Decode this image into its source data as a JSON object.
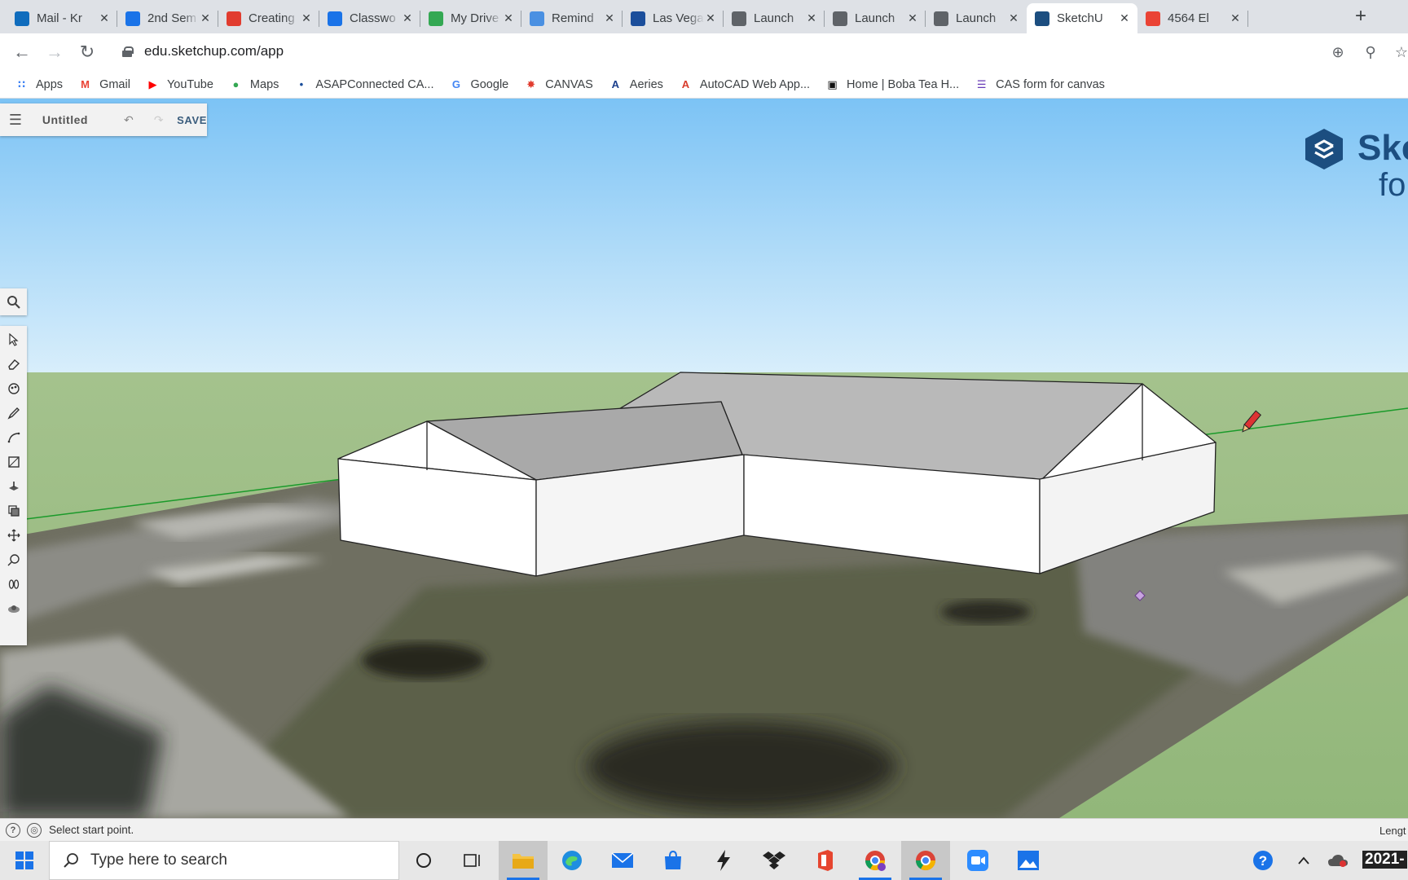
{
  "browser": {
    "tabs": [
      {
        "label": "Mail - Kr",
        "icon": "outlook-icon",
        "color": "#0f6cbd"
      },
      {
        "label": "2nd Sem",
        "icon": "classroom-icon",
        "color": "#1a73e8"
      },
      {
        "label": "Creating",
        "icon": "canvas-icon",
        "color": "#e13c2f"
      },
      {
        "label": "Classwo",
        "icon": "classroom-icon",
        "color": "#1a73e8"
      },
      {
        "label": "My Drive",
        "icon": "drive-icon",
        "color": "#34a853"
      },
      {
        "label": "Remind",
        "icon": "remind-icon",
        "color": "#4a90e2"
      },
      {
        "label": "Las Vega",
        "icon": "golf-icon",
        "color": "#1b4e9b"
      },
      {
        "label": "Launch",
        "icon": "globe-icon",
        "color": "#5f6368"
      },
      {
        "label": "Launch",
        "icon": "globe-icon",
        "color": "#5f6368"
      },
      {
        "label": "Launch",
        "icon": "globe-icon",
        "color": "#5f6368"
      },
      {
        "label": "SketchU",
        "icon": "sketchup-icon",
        "color": "#1c4e80",
        "active": true
      },
      {
        "label": "4564 El",
        "icon": "maps-pin-icon",
        "color": "#ea4335"
      }
    ],
    "url": "edu.sketchup.com/app",
    "bookmarks": [
      {
        "label": "Apps",
        "icon": "apps-grid-icon"
      },
      {
        "label": "Gmail",
        "icon": "gmail-icon"
      },
      {
        "label": "YouTube",
        "icon": "youtube-icon"
      },
      {
        "label": "Maps",
        "icon": "maps-pin-icon"
      },
      {
        "label": "ASAPConnected CA...",
        "icon": "asap-icon"
      },
      {
        "label": "Google",
        "icon": "google-icon"
      },
      {
        "label": "CANVAS",
        "icon": "canvas-icon"
      },
      {
        "label": "Aeries",
        "icon": "aeries-icon"
      },
      {
        "label": "AutoCAD Web App...",
        "icon": "autocad-icon"
      },
      {
        "label": "Home | Boba Tea H...",
        "icon": "square-icon"
      },
      {
        "label": "CAS form for canvas",
        "icon": "forms-icon"
      }
    ]
  },
  "app": {
    "file_name": "Untitled",
    "save_label": "SAVE",
    "brand_name": "Ske",
    "brand_sub": "for S",
    "status_text": "Select start point.",
    "measurement_label": "Lengt"
  },
  "taskbar": {
    "search_placeholder": "Type here to search",
    "clock": "2021-"
  }
}
